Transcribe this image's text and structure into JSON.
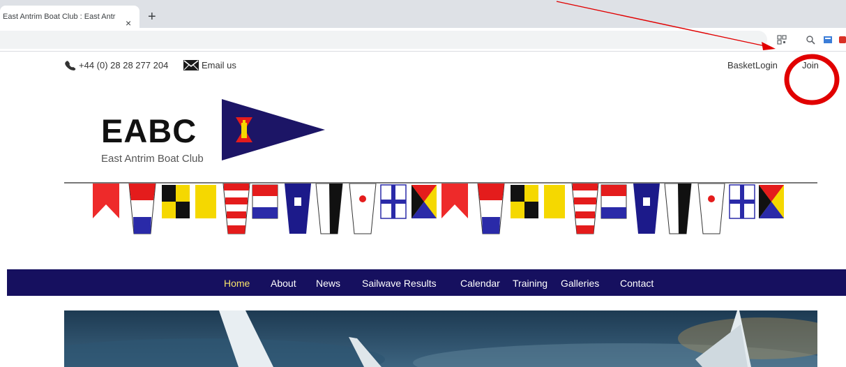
{
  "browser": {
    "tab_title": "East Antrim Boat Club : East Antr",
    "tab_close": "×",
    "new_tab": "+"
  },
  "topbar": {
    "phone": "+44 (0) 28 28 277 204",
    "email": "Email us",
    "basket": "Basket",
    "login": "Login",
    "join": "Join"
  },
  "logo": {
    "abbr": "EABC",
    "name": "East Antrim Boat Club"
  },
  "nav": {
    "items": [
      "Home",
      "About",
      "News",
      "Sailwave Results",
      "Calendar",
      "Training",
      "Galleries",
      "Contact"
    ],
    "active": "Home"
  },
  "colors": {
    "nav_bg": "#16105f",
    "nav_active": "#f7e36a",
    "annotation": "#e10000"
  },
  "icons": [
    "phone-icon",
    "envelope-icon",
    "burgee-icon",
    "qr-code-icon",
    "zoom-icon",
    "extension-icon"
  ]
}
